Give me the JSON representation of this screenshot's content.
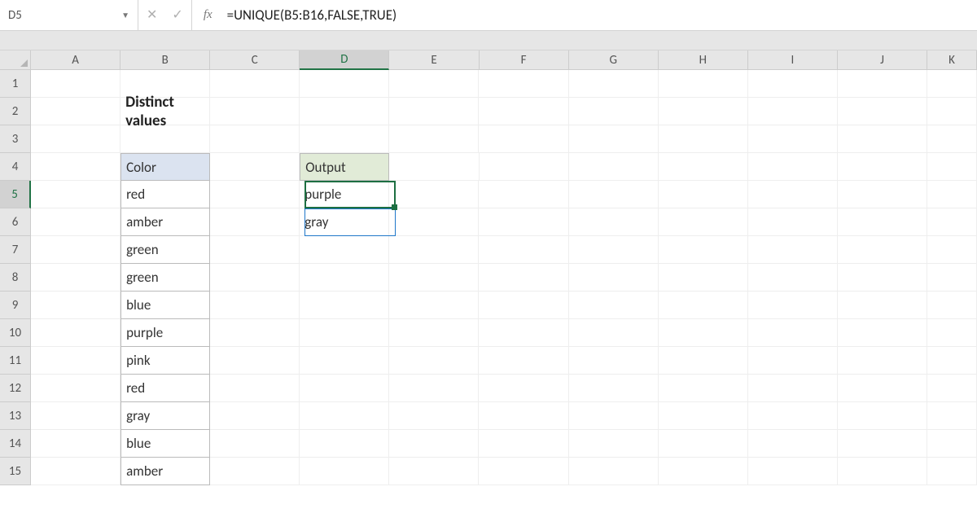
{
  "nameBox": "D5",
  "formula": "=UNIQUE(B5:B16,FALSE,TRUE)",
  "fxLabel": "fx",
  "columns": [
    "A",
    "B",
    "C",
    "D",
    "E",
    "F",
    "G",
    "H",
    "I",
    "J",
    "K"
  ],
  "activeColumn": "D",
  "rows": [
    "1",
    "2",
    "3",
    "4",
    "5",
    "6",
    "7",
    "8",
    "9",
    "10",
    "11",
    "12",
    "13",
    "14",
    "15"
  ],
  "activeRow": "5",
  "title": "Distinct values",
  "headers": {
    "color": "Color",
    "output": "Output"
  },
  "colorValues": [
    "red",
    "amber",
    "green",
    "green",
    "blue",
    "purple",
    "pink",
    "red",
    "gray",
    "blue",
    "amber"
  ],
  "outputValues": [
    "purple",
    "gray"
  ],
  "selection": {
    "cell": "D5",
    "spillTo": "D6"
  }
}
